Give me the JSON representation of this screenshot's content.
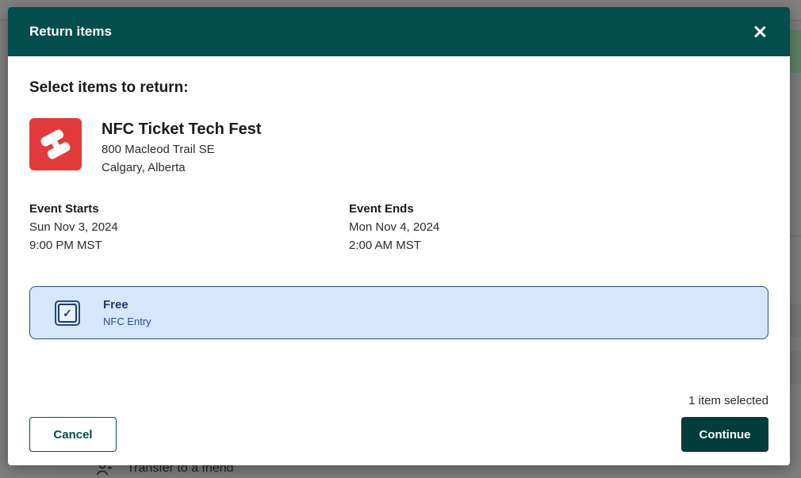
{
  "background": {
    "transfer_label": "Transfer to a friend",
    "transfer_icon": "person-transfer-icon"
  },
  "modal": {
    "title": "Return items",
    "close_icon": "close-icon",
    "heading": "Select items to return:",
    "header_color": "#034d4d"
  },
  "event": {
    "logo_icon": "ticket-logo-icon",
    "logo_color": "#e23a3a",
    "name": "NFC Ticket Tech Fest",
    "address_line1": "800 Macleod Trail SE",
    "address_line2": "Calgary, Alberta",
    "starts_label": "Event Starts",
    "starts_date": "Sun Nov 3, 2024",
    "starts_time": "9:00 PM MST",
    "ends_label": "Event Ends",
    "ends_date": "Mon Nov 4, 2024",
    "ends_time": "2:00 AM MST"
  },
  "tickets": [
    {
      "name": "Free",
      "type": "NFC Entry",
      "checked": true,
      "check_glyph": "✓"
    }
  ],
  "footer": {
    "selected_text": "1 item selected",
    "cancel_label": "Cancel",
    "continue_label": "Continue"
  }
}
